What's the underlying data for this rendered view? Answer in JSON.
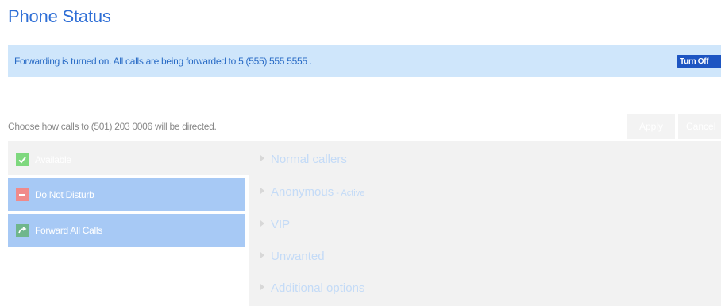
{
  "page": {
    "title": "Phone Status"
  },
  "banner": {
    "message": "Forwarding is turned on. All calls are being forwarded to 5 (555) 555 5555 .",
    "turn_off_label": "Turn Off"
  },
  "instructions": "Choose how calls to (501) 203 0006 will be directed.",
  "actions": {
    "apply": "Apply",
    "cancel": "Cancel"
  },
  "status_options": [
    {
      "label": "Available",
      "icon": "check-icon"
    },
    {
      "label": "Do Not Disturb",
      "icon": "minus-icon"
    },
    {
      "label": "Forward All Calls",
      "icon": "forward-arrow-icon"
    }
  ],
  "caller_rules": [
    {
      "label": "Normal callers",
      "badge": ""
    },
    {
      "label": "Anonymous",
      "badge": " - Active"
    },
    {
      "label": "VIP",
      "badge": ""
    },
    {
      "label": "Unwanted",
      "badge": ""
    },
    {
      "label": "Additional options",
      "badge": ""
    }
  ],
  "colors": {
    "title": "#2f6fd6",
    "banner_bg": "#cfe6fb",
    "turn_off_bg": "#1d55c2",
    "option_selected_bg": "#a7c9f5"
  }
}
